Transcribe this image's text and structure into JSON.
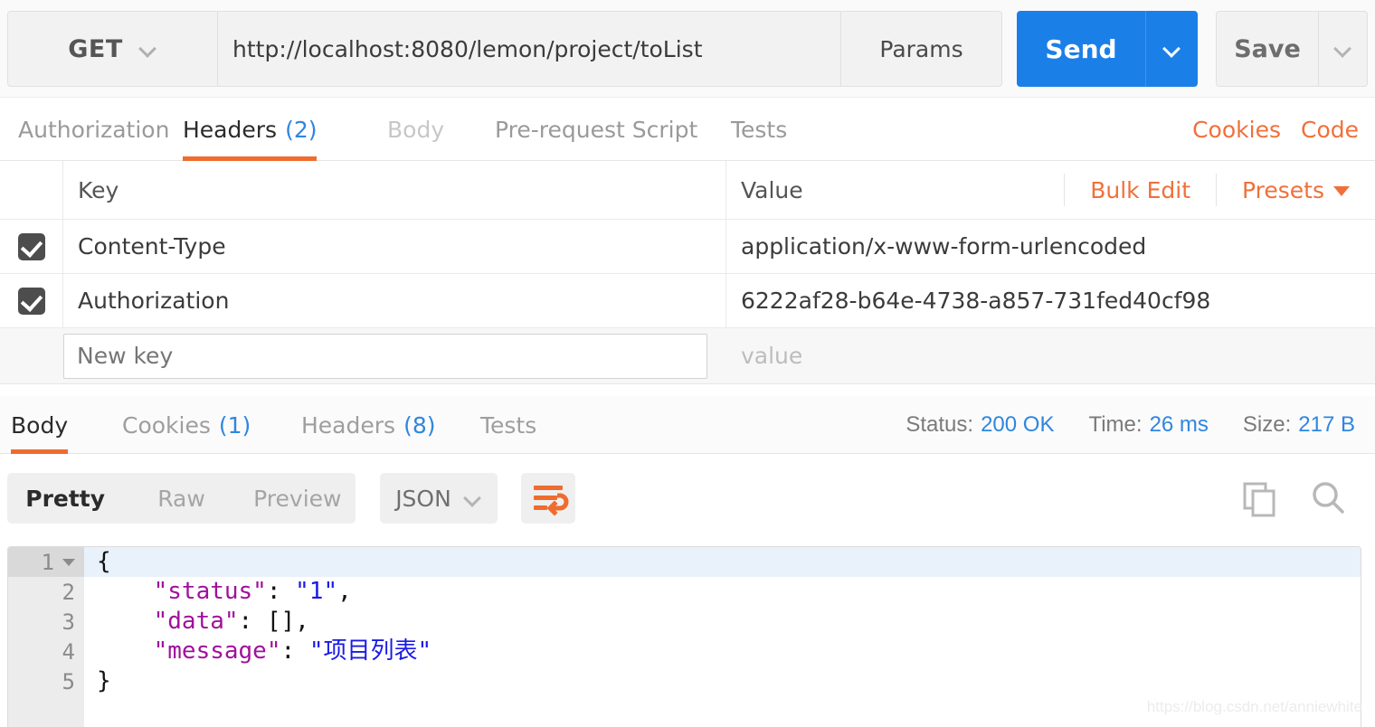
{
  "request_bar": {
    "method": "GET",
    "url": "http://localhost:8080/lemon/project/toList",
    "params_label": "Params",
    "send_label": "Send",
    "save_label": "Save"
  },
  "request_tabs": [
    {
      "label": "Authorization",
      "count": "",
      "state": "normal"
    },
    {
      "label": "Headers",
      "count": "(2)",
      "state": "active"
    },
    {
      "label": "Body",
      "count": "",
      "state": "dim"
    },
    {
      "label": "Pre-request Script",
      "count": "",
      "state": "normal"
    },
    {
      "label": "Tests",
      "count": "",
      "state": "normal"
    }
  ],
  "request_links": {
    "cookies": "Cookies",
    "code": "Code"
  },
  "headers_table": {
    "col_key": "Key",
    "col_value": "Value",
    "bulk_edit": "Bulk Edit",
    "presets": "Presets",
    "rows": [
      {
        "checked": true,
        "key": "Content-Type",
        "value": "application/x-www-form-urlencoded"
      },
      {
        "checked": true,
        "key": "Authorization",
        "value": "6222af28-b64e-4738-a857-731fed40cf98"
      }
    ],
    "new_row": {
      "key_placeholder": "New key",
      "value_placeholder": "value"
    }
  },
  "response_tabs": [
    {
      "label": "Body",
      "count": "",
      "state": "active"
    },
    {
      "label": "Cookies",
      "count": "(1)",
      "state": "normal"
    },
    {
      "label": "Headers",
      "count": "(8)",
      "state": "normal"
    },
    {
      "label": "Tests",
      "count": "",
      "state": "normal"
    }
  ],
  "response_meta": {
    "status_label": "Status:",
    "status_value": "200 OK",
    "time_label": "Time:",
    "time_value": "26 ms",
    "size_label": "Size:",
    "size_value": "217 B"
  },
  "body_toolbar": {
    "views": [
      "Pretty",
      "Raw",
      "Preview"
    ],
    "active_view": "Pretty",
    "format": "JSON",
    "wrap_icon": "word-wrap-icon",
    "copy_icon": "copy-icon",
    "search_icon": "search-icon"
  },
  "code_lines": [
    {
      "num": "1",
      "foldable": true,
      "highlight": true,
      "segments": [
        {
          "t": "{",
          "c": "p"
        }
      ]
    },
    {
      "num": "2",
      "foldable": false,
      "highlight": false,
      "segments": [
        {
          "t": "    \"status\"",
          "c": "k"
        },
        {
          "t": ": ",
          "c": "p"
        },
        {
          "t": "\"1\"",
          "c": "s"
        },
        {
          "t": ",",
          "c": "p"
        }
      ]
    },
    {
      "num": "3",
      "foldable": false,
      "highlight": false,
      "segments": [
        {
          "t": "    \"data\"",
          "c": "k"
        },
        {
          "t": ": [],",
          "c": "p"
        }
      ]
    },
    {
      "num": "4",
      "foldable": false,
      "highlight": false,
      "segments": [
        {
          "t": "    \"message\"",
          "c": "k"
        },
        {
          "t": ": ",
          "c": "p"
        },
        {
          "t": "\"项目列表\"",
          "c": "s"
        }
      ]
    },
    {
      "num": "5",
      "foldable": false,
      "highlight": false,
      "segments": [
        {
          "t": "}",
          "c": "p"
        }
      ]
    }
  ],
  "watermark": "https://blog.csdn.net/anniewhite",
  "colors": {
    "accent_orange": "#ef6c2e",
    "link_orange": "#f0703a",
    "send_blue": "#1b7fe8",
    "meta_blue": "#2f86e0",
    "json_key": "#a0119b",
    "json_string": "#1a1ae6"
  }
}
